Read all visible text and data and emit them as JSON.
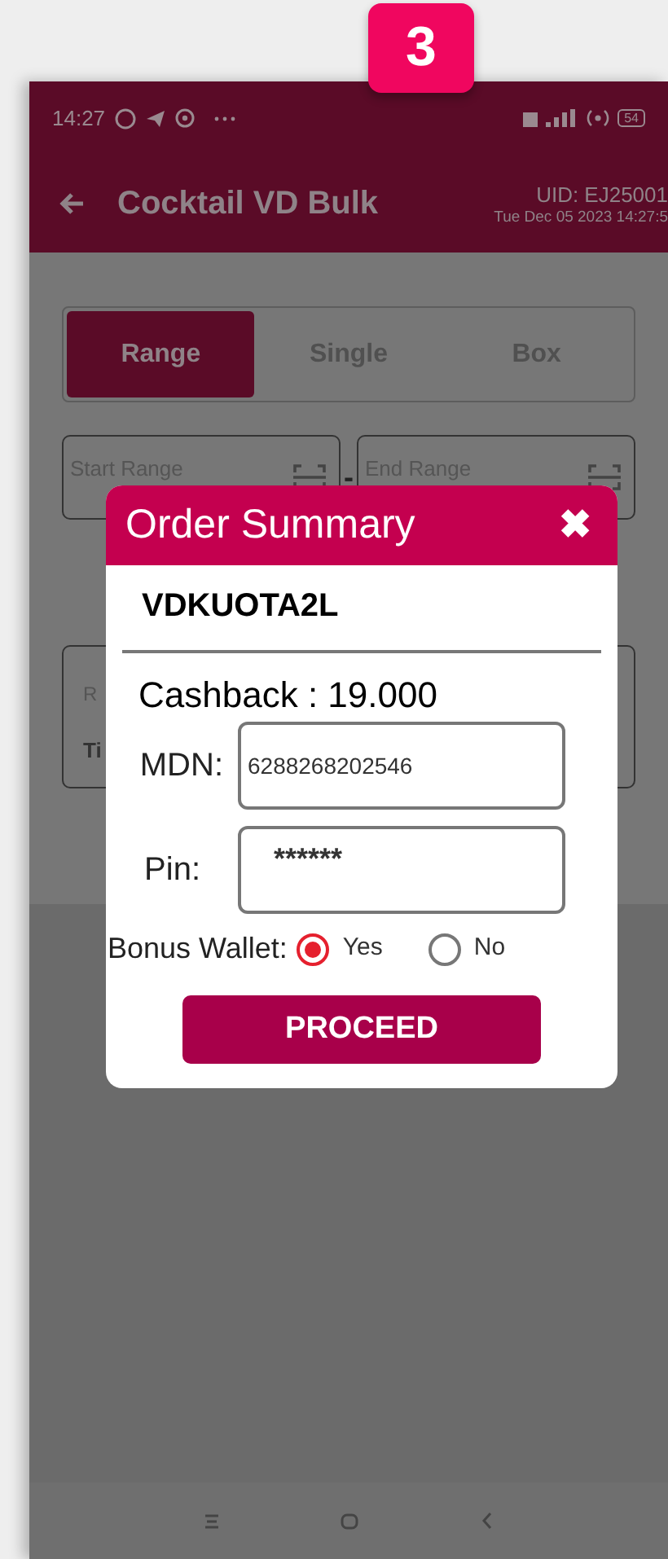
{
  "step_badge": "3",
  "status_bar": {
    "time": "14:27",
    "battery": "54"
  },
  "header": {
    "title": "Cocktail VD Bulk",
    "uid": "UID: EJ25001",
    "datetime": "Tue Dec 05 2023 14:27:5"
  },
  "tabs": [
    {
      "label": "Range",
      "selected": true
    },
    {
      "label": "Single",
      "selected": false
    },
    {
      "label": "Box",
      "selected": false
    }
  ],
  "range_fields": [
    {
      "placeholder": "Start Range"
    },
    {
      "placeholder": "End Range"
    }
  ],
  "range_separator": "-",
  "hidden_card": {
    "line_1": "R",
    "line_2": "Ti"
  },
  "dialog": {
    "title": "Order Summary",
    "close": "✖",
    "product": "VDKUOTA2L",
    "cashback": "Cashback : 19.000",
    "fields": [
      {
        "label": "MDN:",
        "value": "6288268202546"
      },
      {
        "label": "Pin:",
        "value": "******"
      }
    ],
    "bonus_wallet": {
      "label": "Bonus Wallet:",
      "options": [
        {
          "label": "Yes",
          "selected": true
        },
        {
          "label": "No",
          "selected": false
        }
      ]
    },
    "button": "PROCEED"
  }
}
